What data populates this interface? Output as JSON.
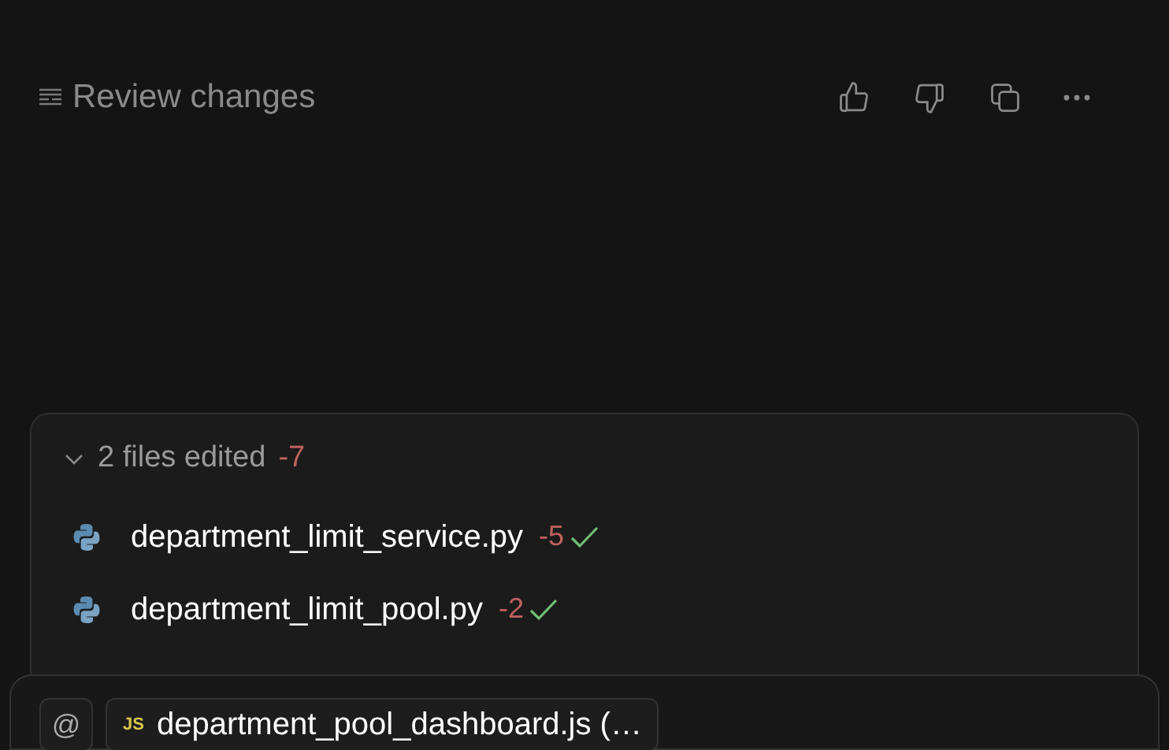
{
  "header": {
    "title": "Review changes"
  },
  "edits": {
    "expanded": true,
    "summary": "2 files edited",
    "deleted": "-7",
    "files": [
      {
        "name": "department_limit_service.py",
        "deleted": "-5",
        "accepted": true
      },
      {
        "name": "department_limit_pool.py",
        "deleted": "-2",
        "accepted": true
      }
    ]
  },
  "composer": {
    "mention": "@",
    "context_chip": {
      "badge": "JS",
      "label": "department_pool_dashboard.js (…"
    }
  }
}
